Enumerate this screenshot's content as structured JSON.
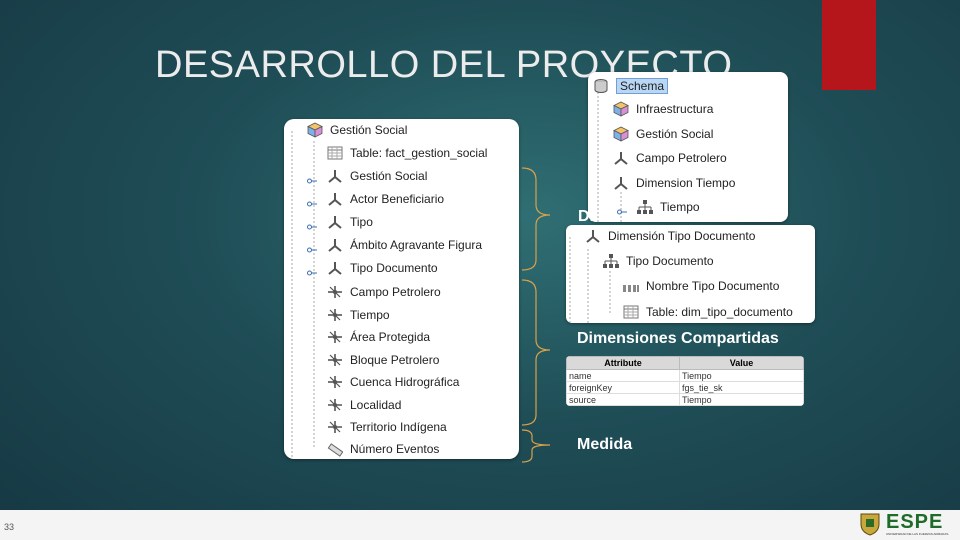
{
  "slide": {
    "title": "DESARROLLO DEL PROYECTO",
    "page_number": "33",
    "logo_text": "ESPE",
    "logo_caption": "UNIVERSIDAD DE LAS FUERZAS ARMADAS"
  },
  "cube_tree": {
    "root": "Gestión Social",
    "table": "Table: fact_gestion_social",
    "dimension_usages": [
      "Gestión Social",
      "Actor Beneficiario",
      "Tipo",
      "Ámbito Agravante Figura",
      "Tipo Documento"
    ],
    "shared_usages": [
      "Campo Petrolero",
      "Tiempo",
      "Área Protegida",
      "Bloque Petrolero",
      "Cuenca Hidrográfica",
      "Localidad",
      "Territorio Indígena"
    ],
    "measure": "Número Eventos"
  },
  "schema_tree": {
    "root": "Schema",
    "items": [
      "Infraestructura",
      "Gestión Social",
      "Campo Petrolero",
      "Dimension Tiempo",
      "Tiempo"
    ]
  },
  "dimension_tree": {
    "dimension": "Dimensión Tipo Documento",
    "hierarchy": "Tipo Documento",
    "level": "Nombre Tipo Documento",
    "table": "Table: dim_tipo_documento"
  },
  "labels": {
    "dimensions": "Di",
    "shared": "Dimensiones Compartidas",
    "measure": "Medida"
  },
  "attributes": {
    "headers": [
      "Attribute",
      "Value"
    ],
    "rows": [
      {
        "attr": "name",
        "value": "Tiempo"
      },
      {
        "attr": "foreignKey",
        "value": "fgs_tie_sk"
      },
      {
        "attr": "source",
        "value": "Tiempo"
      }
    ]
  }
}
